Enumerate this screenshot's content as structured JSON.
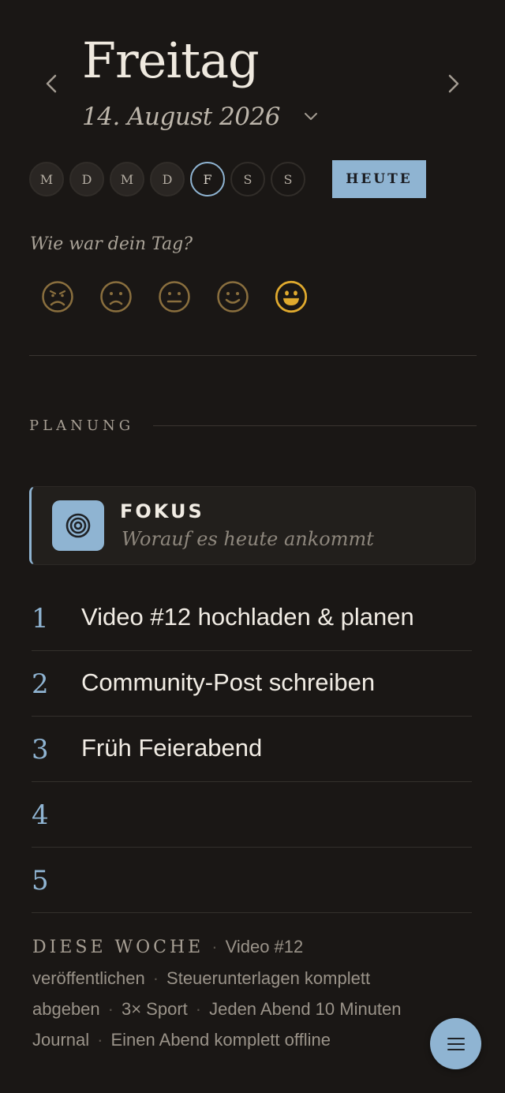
{
  "header": {
    "day_name": "Freitag",
    "date": "14. August 2026",
    "prev_icon": "chevron-left-icon",
    "next_icon": "chevron-right-icon",
    "date_picker_icon": "chevron-down-icon"
  },
  "weekdays": [
    {
      "label": "M",
      "active": false
    },
    {
      "label": "D",
      "active": false
    },
    {
      "label": "M",
      "active": false
    },
    {
      "label": "D",
      "active": false
    },
    {
      "label": "F",
      "active": true
    },
    {
      "label": "S",
      "active": false
    },
    {
      "label": "S",
      "active": false
    }
  ],
  "today_button": "HEUTE",
  "mood": {
    "question": "Wie war dein Tag?",
    "options": [
      "angry-face-icon",
      "sad-face-icon",
      "neutral-face-icon",
      "smile-face-icon",
      "grin-face-icon"
    ],
    "selected_index": 4,
    "colors": {
      "inactive": "#8a6f3e",
      "selected": "#e0aa2e"
    }
  },
  "planning": {
    "section_label": "PLANUNG",
    "focus": {
      "icon": "target-icon",
      "title": "FOKUS",
      "subtitle": "Worauf es heute ankommt"
    },
    "tasks": [
      {
        "num": "1",
        "text": "Video #12 hochladen & planen"
      },
      {
        "num": "2",
        "text": "Community-Post schreiben"
      },
      {
        "num": "3",
        "text": "Früh Feierabend"
      },
      {
        "num": "4",
        "text": ""
      },
      {
        "num": "5",
        "text": ""
      }
    ]
  },
  "week": {
    "label": "DIESE WOCHE",
    "goals": [
      "Video #12 veröffentlichen",
      "Steuerunterlagen komplett abgeben",
      "3× Sport",
      "Jeden Abend 10 Minuten Journal",
      "Einen Abend komplett offline"
    ],
    "separator": "·"
  },
  "fab": {
    "icon": "menu-icon"
  },
  "colors": {
    "background": "#1a1715",
    "accent": "#8fb4d2",
    "mood_selected": "#e0aa2e"
  }
}
